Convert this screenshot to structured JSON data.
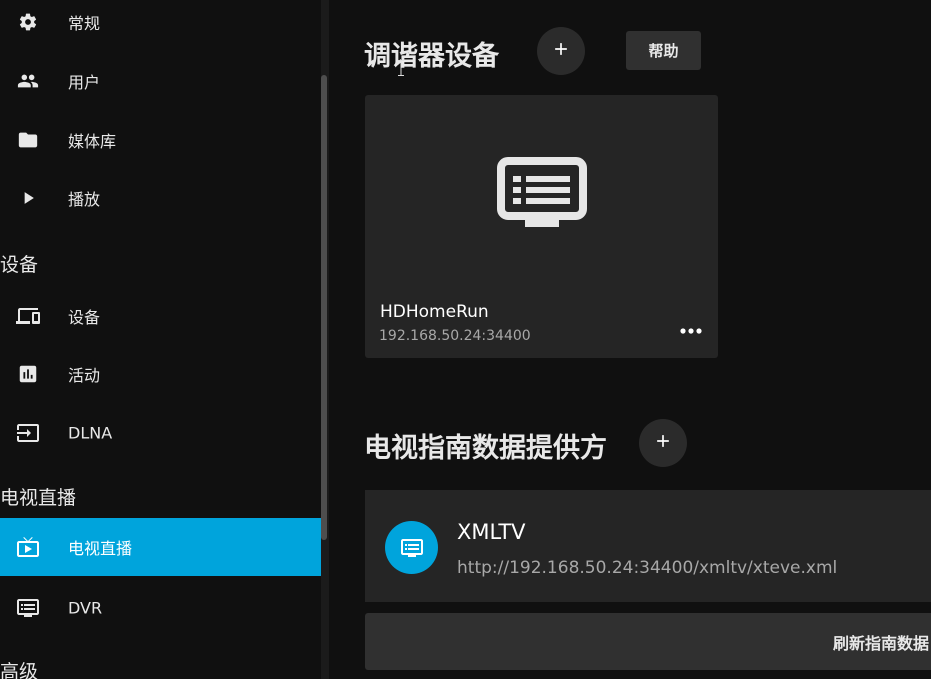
{
  "sidebar": {
    "items": [
      {
        "label": "常规",
        "icon": "gear-icon"
      },
      {
        "label": "用户",
        "icon": "people-icon"
      },
      {
        "label": "媒体库",
        "icon": "folder-icon"
      },
      {
        "label": "播放",
        "icon": "play-icon"
      },
      {
        "label": "设备",
        "icon": "devices-icon"
      },
      {
        "label": "活动",
        "icon": "chart-icon"
      },
      {
        "label": "DLNA",
        "icon": "input-icon"
      },
      {
        "label": "电视直播",
        "icon": "live-tv-icon",
        "active": true
      },
      {
        "label": "DVR",
        "icon": "dvr-icon"
      }
    ],
    "sections": {
      "devices": "设备",
      "livetv": "电视直播",
      "advanced": "高级"
    }
  },
  "tuners": {
    "title": "调谐器设备",
    "add_label": "+",
    "help_label": "帮助",
    "device": {
      "name": "HDHomeRun",
      "address": "192.168.50.24:34400"
    }
  },
  "guide": {
    "title": "电视指南数据提供方",
    "add_label": "+",
    "provider": {
      "name": "XMLTV",
      "url": "http://192.168.50.24:34400/xmltv/xteve.xml"
    },
    "refresh_label": "刷新指南数据"
  },
  "colors": {
    "accent": "#00a4dc",
    "background": "#101010",
    "card": "#252525",
    "button": "#303030"
  }
}
